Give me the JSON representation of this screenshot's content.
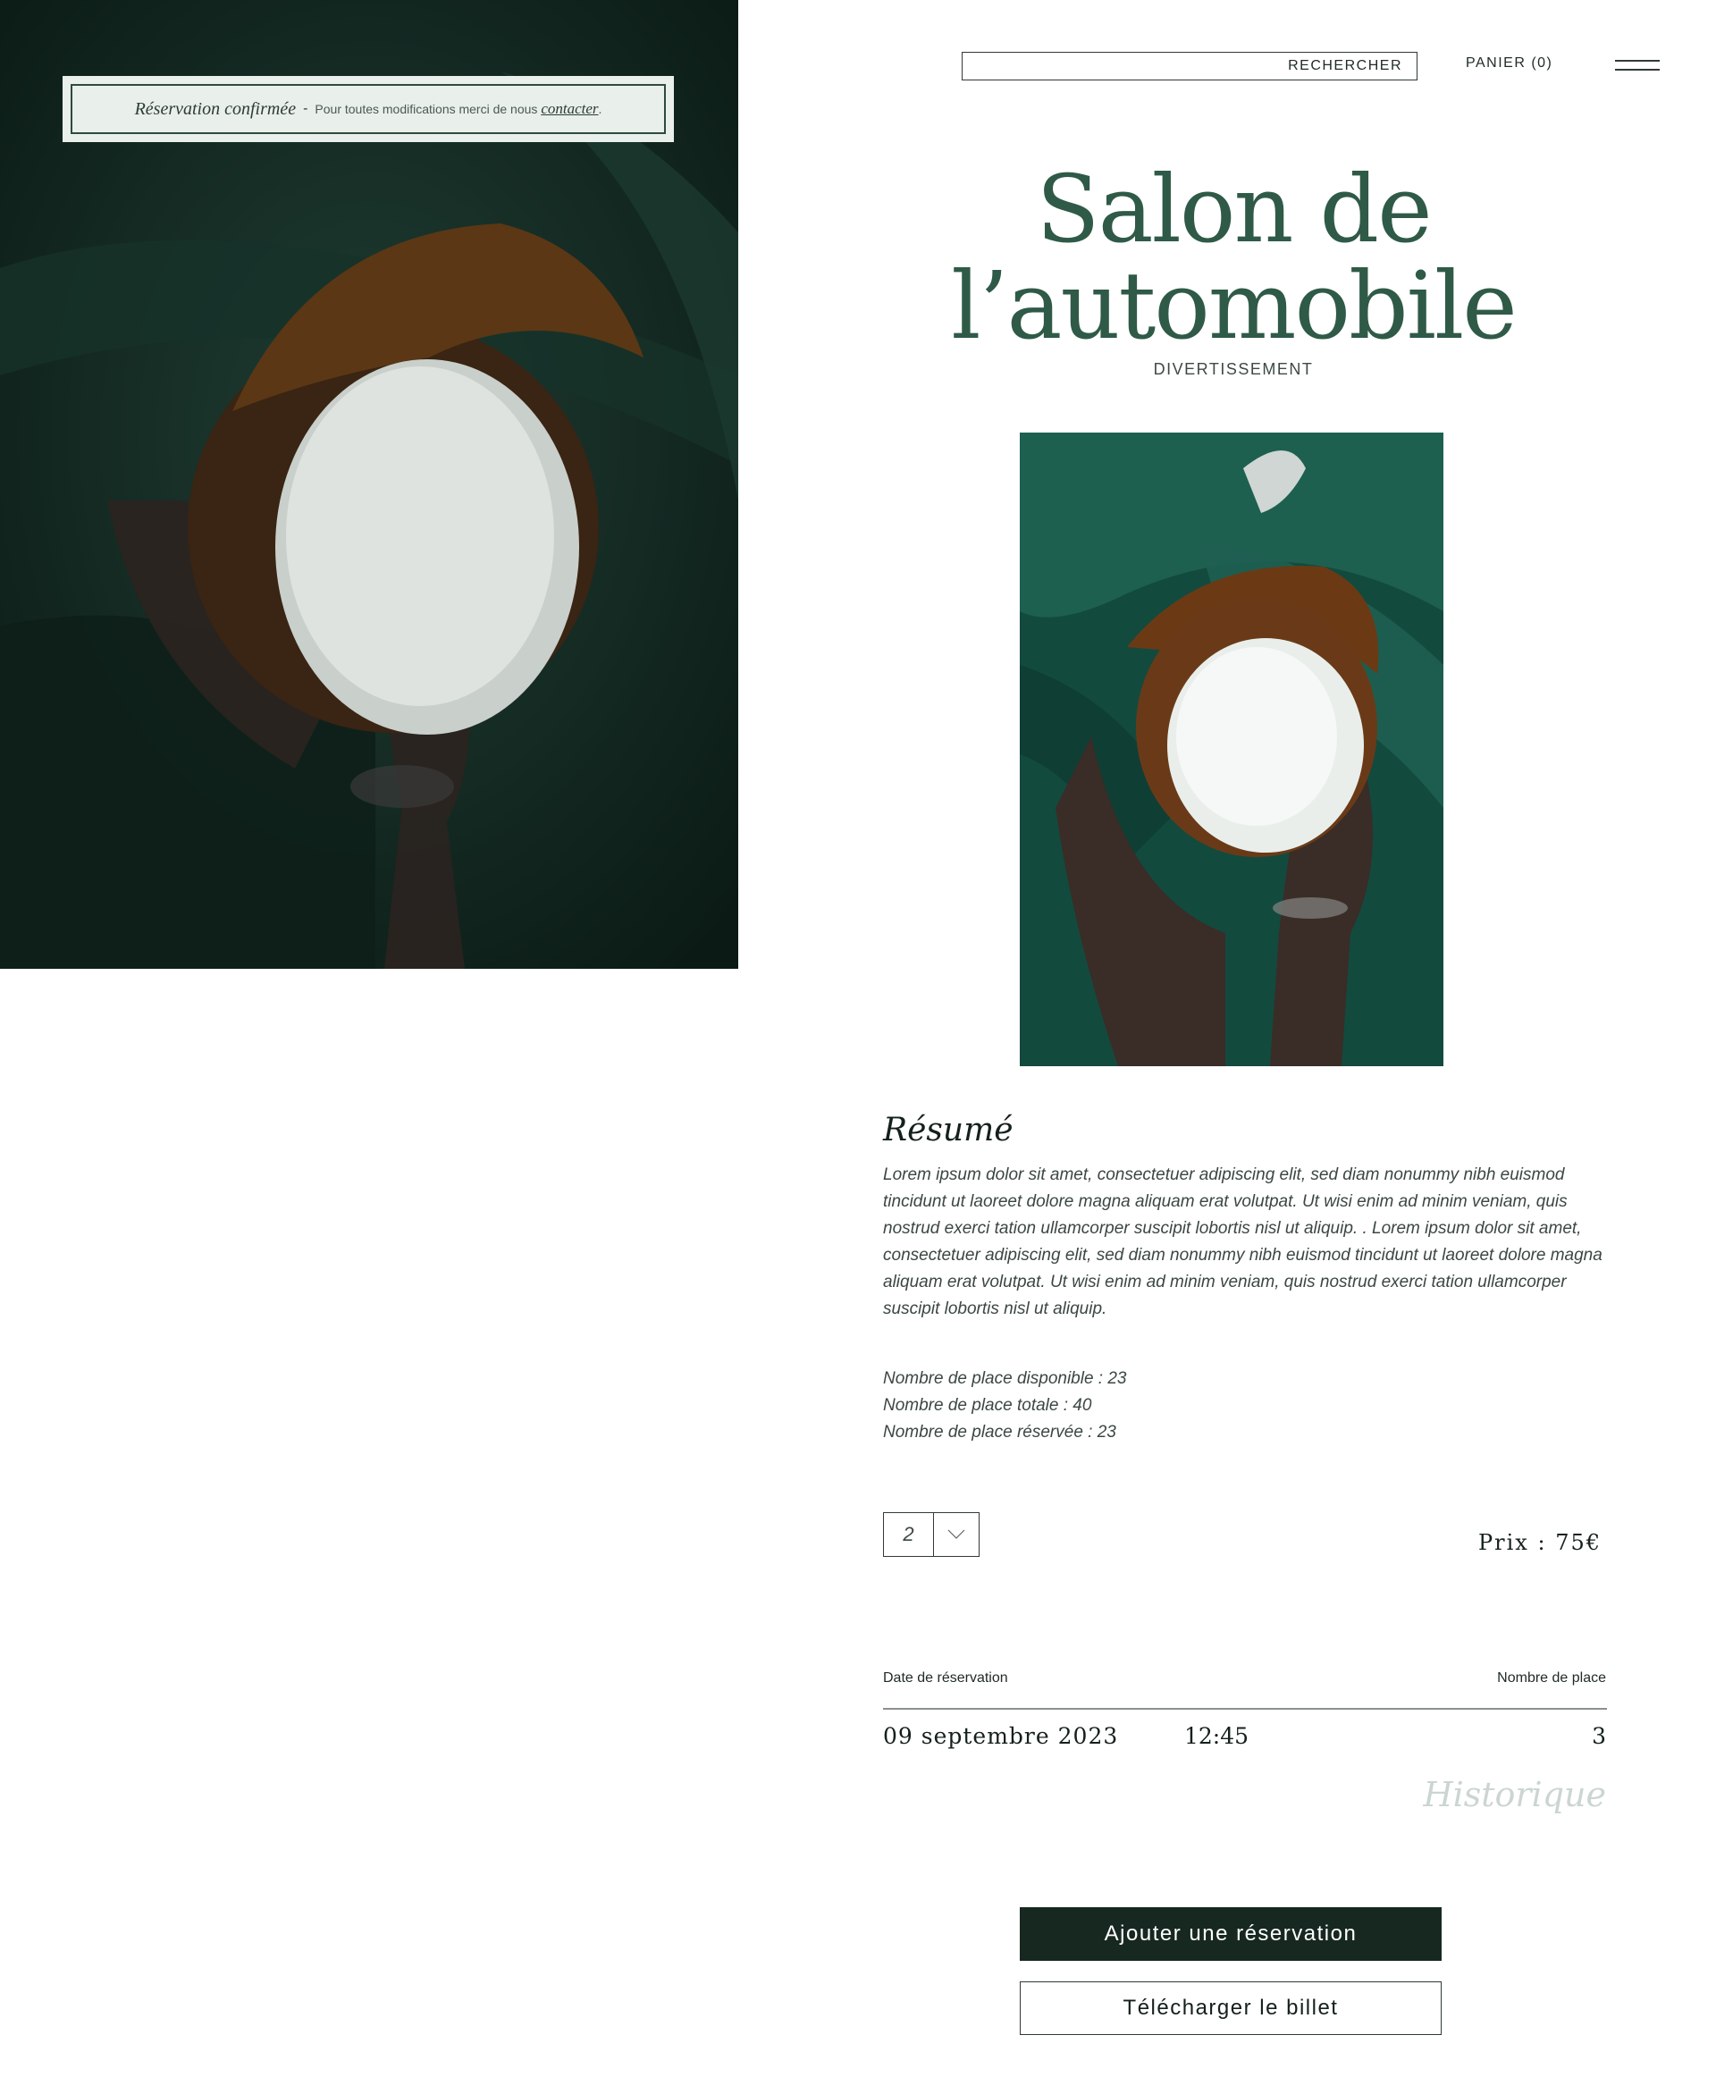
{
  "banner": {
    "title": "Réservation confirmée",
    "separator": "-",
    "text": "Pour toutes modifications merci de nous",
    "link": "contacter",
    "suffix": "."
  },
  "nav": {
    "search_label": "RECHERCHER",
    "cart_label": "PANIER (0)",
    "menu_icon": "hamburger-icon"
  },
  "event": {
    "title_line1": "Salon de",
    "title_line2": "l’automobile",
    "category": "DIVERTISSEMENT",
    "image": "coconut-hands-photo"
  },
  "summary": {
    "title": "Résumé",
    "body": "Lorem ipsum dolor sit amet, consectetuer adipiscing elit, sed diam nonummy nibh euismod tincidunt ut laoreet dolore magna aliquam erat volutpat. Ut wisi enim ad minim veniam, quis nostrud exerci tation ullamcorper suscipit lobortis nisl ut aliquip. . Lorem ipsum dolor sit amet, consectetuer adipiscing elit, sed diam nonummy nibh euismod tincidunt ut laoreet dolore magna aliquam erat volutpat. Ut wisi enim ad minim veniam, quis nostrud exerci tation ullamcorper suscipit lobortis nisl ut aliquip."
  },
  "stats": {
    "available": "Nombre de place disponible : 23",
    "total": "Nombre de place totale : 40",
    "reserved": "Nombre de place réservée : 23"
  },
  "booking": {
    "quantity": "2",
    "price_label": "Prix",
    "price_sep": ":",
    "price_value": "75€"
  },
  "reservations": {
    "header_date": "Date de réservation",
    "header_places": "Nombre de place",
    "rows": [
      {
        "date": "09 septembre 2023",
        "time": "12:45",
        "places": "3"
      }
    ],
    "history_label": "Historique"
  },
  "actions": {
    "add_label": "Ajouter une réservation",
    "download_label": "Télécharger le billet"
  },
  "colors": {
    "accent_green": "#2f5a47",
    "dark": "#172821",
    "banner_bg": "#e9efea",
    "history": "#ccd6d1"
  }
}
